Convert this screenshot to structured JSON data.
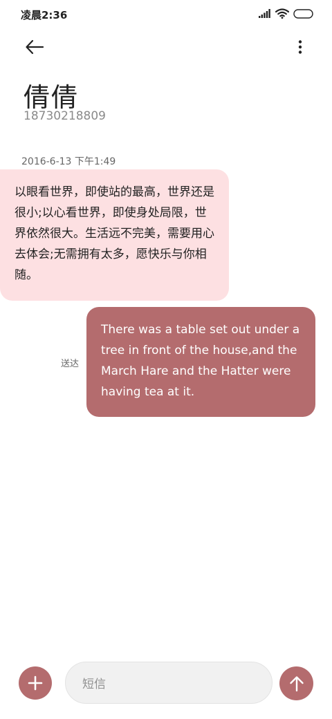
{
  "status_bar": {
    "time": "凌晨2:36"
  },
  "icons": {
    "back": "arrow-left-icon",
    "more": "more-vertical-icon",
    "add": "plus-icon",
    "send": "arrow-up-icon"
  },
  "colors": {
    "accent": "#b46c6e",
    "incoming_bubble": "#fde0e2",
    "input_background": "#f1f1f1"
  },
  "header": {
    "contact_name": "倩倩",
    "contact_number": "18730218809"
  },
  "conversation": {
    "timestamp": "2016-6-13 下午1:49",
    "messages": [
      {
        "direction": "incoming",
        "text": "以眼看世界，即使站的最高，世界还是很小;以心看世界，即使身处局限，世界依然很大。生活远不完美，需要用心去体会;无需拥有太多，愿快乐与你相随。"
      },
      {
        "direction": "outgoing",
        "status": "送达",
        "text": "There was a table set out under a tree in front of the house,and the March Hare and the Hatter were having tea at it."
      }
    ]
  },
  "composer": {
    "placeholder": "短信"
  }
}
